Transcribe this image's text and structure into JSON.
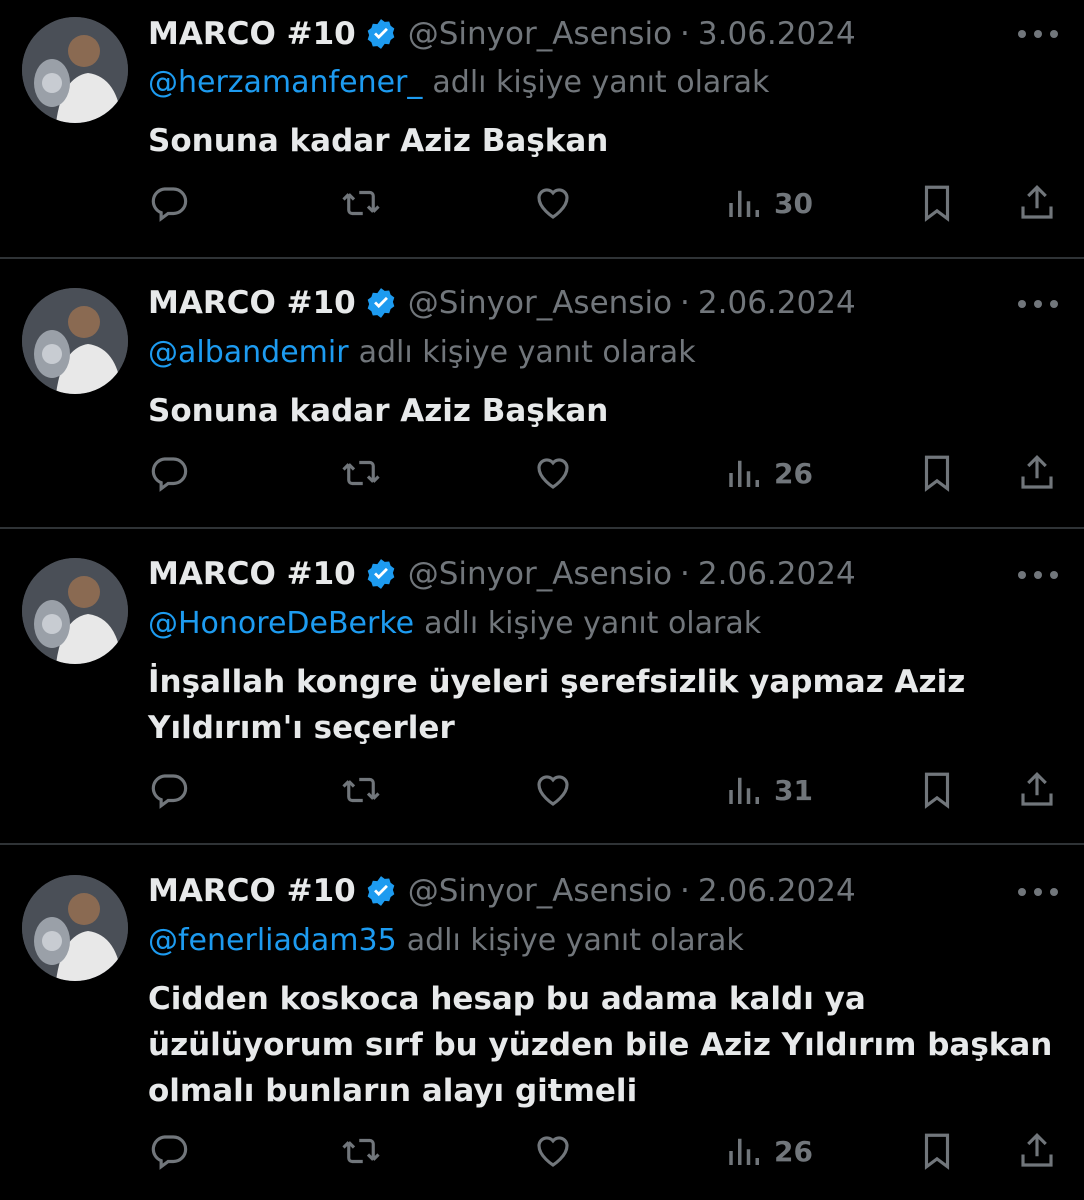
{
  "tweets": [
    {
      "name": "MARCO #10",
      "handle": "@Sinyor_Asensio",
      "date": "3.06.2024",
      "reply_to": "@herzamanfener_",
      "reply_suffix": "adlı kişiye yanıt olarak",
      "text_lines": [
        "Sonuna kadar Aziz Başkan"
      ],
      "views": "30"
    },
    {
      "name": "MARCO #10",
      "handle": "@Sinyor_Asensio",
      "date": "2.06.2024",
      "reply_to": "@albandemir",
      "reply_suffix": "adlı kişiye yanıt olarak",
      "text_lines": [
        "Sonuna kadar Aziz Başkan"
      ],
      "views": "26"
    },
    {
      "name": "MARCO #10",
      "handle": "@Sinyor_Asensio",
      "date": "2.06.2024",
      "reply_to": "@HonoreDeBerke",
      "reply_suffix": "adlı kişiye yanıt olarak",
      "text_lines": [
        "İnşallah kongre üyeleri şerefsizlik yapmaz Aziz",
        "Yıldırım'ı seçerler"
      ],
      "views": "31"
    },
    {
      "name": "MARCO #10",
      "handle": "@Sinyor_Asensio",
      "date": "2.06.2024",
      "reply_to": "@fenerliadam35",
      "reply_suffix": "adlı kişiye yanıt olarak",
      "text_lines": [
        "Cidden koskoca hesap bu adama kaldı ya",
        "üzülüyorum sırf bu yüzden bile Aziz Yıldırım başkan",
        "olmalı bunların alayı gitmeli"
      ],
      "views": "26"
    }
  ],
  "icons": {
    "reply": "reply-icon",
    "retweet": "retweet-icon",
    "like": "heart-icon",
    "views": "views-icon",
    "bookmark": "bookmark-icon",
    "share": "share-icon",
    "verified": "verified-badge-icon",
    "more": "more-options-icon"
  },
  "colors": {
    "background": "#000000",
    "text": "#e7e9ea",
    "muted": "#71767b",
    "link": "#1d9bf0",
    "divider": "#2f3336"
  }
}
